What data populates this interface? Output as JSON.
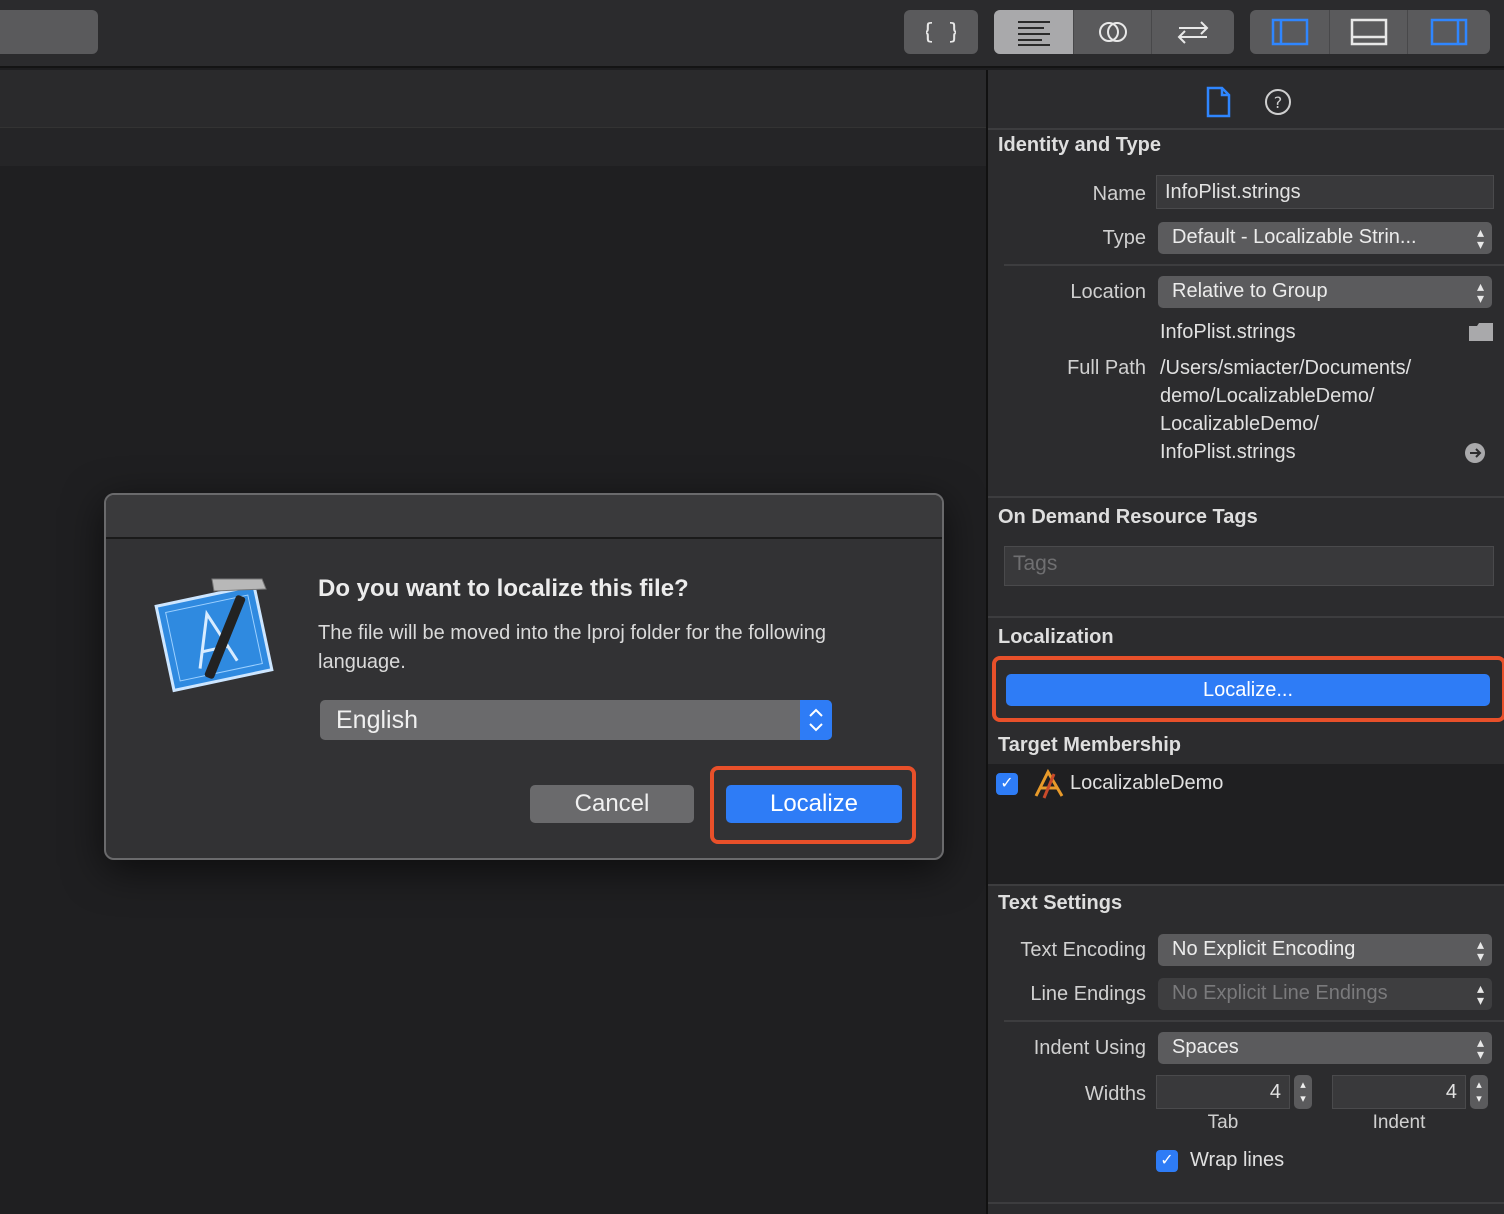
{
  "toolbar": {
    "buttons": [
      "code-review",
      "editor-standard",
      "editor-assistant",
      "editor-version",
      "navigator-toggle",
      "debug-toggle",
      "inspector-toggle"
    ]
  },
  "dialog": {
    "title": "Do you want to localize this file?",
    "message": "The file will be moved into the lproj folder for the following language.",
    "language": "English",
    "cancel_label": "Cancel",
    "localize_label": "Localize"
  },
  "inspector": {
    "identity": {
      "section_title": "Identity and Type",
      "name_label": "Name",
      "name_value": "InfoPlist.strings",
      "type_label": "Type",
      "type_value": "Default - Localizable Strin...",
      "location_label": "Location",
      "location_value": "Relative to Group",
      "location_file": "InfoPlist.strings",
      "fullpath_label": "Full Path",
      "fullpath_lines": [
        "/Users/smiacter/Documents/",
        "demo/LocalizableDemo/",
        "LocalizableDemo/",
        "InfoPlist.strings"
      ]
    },
    "odr": {
      "section_title": "On Demand Resource Tags",
      "tags_placeholder": "Tags"
    },
    "localization": {
      "section_title": "Localization",
      "button_label": "Localize..."
    },
    "target": {
      "section_title": "Target Membership",
      "item_label": "LocalizableDemo"
    },
    "text_settings": {
      "section_title": "Text Settings",
      "encoding_label": "Text Encoding",
      "encoding_value": "No Explicit Encoding",
      "line_endings_label": "Line Endings",
      "line_endings_value": "No Explicit Line Endings",
      "indent_label": "Indent Using",
      "indent_value": "Spaces",
      "widths_label": "Widths",
      "tab_value": "4",
      "indent_width_value": "4",
      "tab_caption": "Tab",
      "indent_caption": "Indent",
      "wrap_label": "Wrap lines"
    }
  },
  "colors": {
    "accent": "#2e7cf6",
    "highlight": "#e8502a"
  }
}
